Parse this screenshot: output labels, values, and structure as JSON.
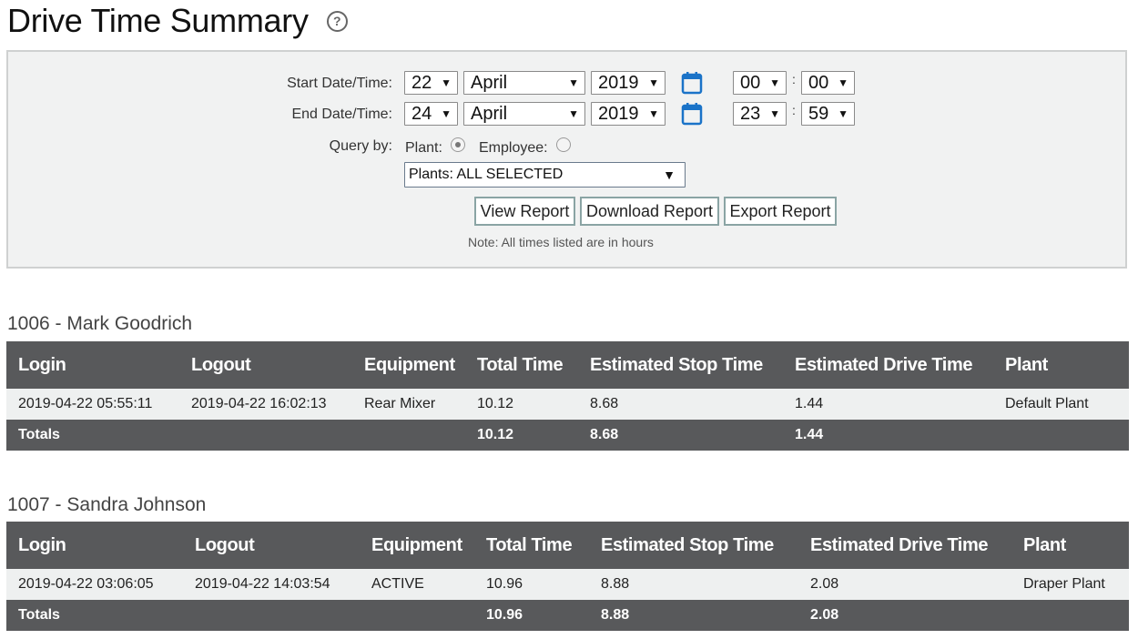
{
  "header": {
    "title": "Drive Time Summary",
    "help_icon": "question-circle-icon"
  },
  "form": {
    "start_label": "Start Date/Time:",
    "end_label": "End Date/Time:",
    "start": {
      "day": "22",
      "month": "April",
      "year": "2019",
      "hour": "00",
      "minute": "00"
    },
    "end": {
      "day": "24",
      "month": "April",
      "year": "2019",
      "hour": "23",
      "minute": "59"
    },
    "colon": ":",
    "query_by_label": "Query by:",
    "plant_label": "Plant:",
    "employee_label": "Employee:",
    "query_by_selected": "plant",
    "plants_select": "Plants: ALL SELECTED",
    "buttons": {
      "view": "View Report",
      "download": "Download Report",
      "export": "Export Report"
    },
    "note": "Note: All times listed are in hours",
    "calendar_icon": "calendar-icon",
    "accent_color": "#1a73c8"
  },
  "reports": [
    {
      "title": "1006 - Mark Goodrich",
      "columns": [
        "Login",
        "Logout",
        "Equipment",
        "Total Time",
        "Estimated Stop Time",
        "Estimated Drive Time",
        "Plant"
      ],
      "rows": [
        [
          "2019-04-22 05:55:11",
          "2019-04-22 16:02:13",
          "Rear Mixer",
          "10.12",
          "8.68",
          "1.44",
          "Default Plant"
        ]
      ],
      "totals": [
        "Totals",
        "",
        "",
        "10.12",
        "8.68",
        "1.44",
        ""
      ]
    },
    {
      "title": "1007 - Sandra Johnson",
      "columns": [
        "Login",
        "Logout",
        "Equipment",
        "Total Time",
        "Estimated Stop Time",
        "Estimated Drive Time",
        "Plant"
      ],
      "rows": [
        [
          "2019-04-22 03:06:05",
          "2019-04-22 14:03:54",
          "ACTIVE",
          "10.96",
          "8.88",
          "2.08",
          "Draper Plant"
        ]
      ],
      "totals": [
        "Totals",
        "",
        "",
        "10.96",
        "8.88",
        "2.08",
        ""
      ]
    }
  ]
}
